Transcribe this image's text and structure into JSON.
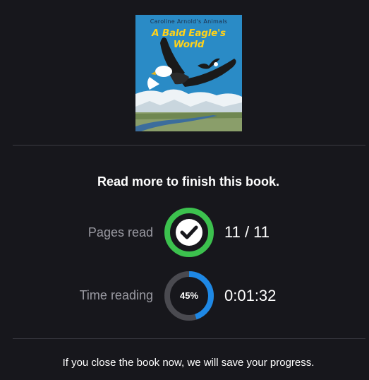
{
  "book": {
    "series": "Caroline Arnold's Animals",
    "title": "A Bald Eagle's World"
  },
  "heading": "Read more to finish this book.",
  "stats": {
    "pages": {
      "label": "Pages read",
      "value": "11 / 11",
      "status": "complete",
      "icon": "checkmark-icon",
      "color": "#3cc14e"
    },
    "time": {
      "label": "Time reading",
      "value": "0:01:32",
      "percent_label": "45%",
      "progress": 0.45,
      "color": "#1e88e5",
      "track_color": "#4a4a50"
    }
  },
  "footer": "If you close the book now, we will save your progress."
}
